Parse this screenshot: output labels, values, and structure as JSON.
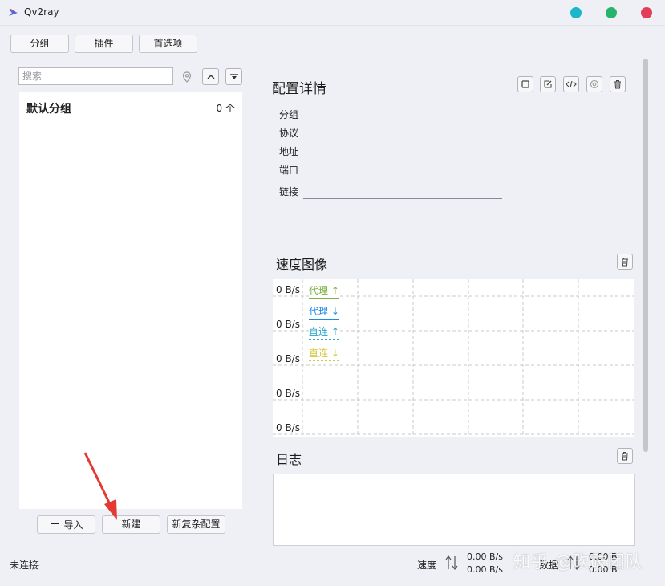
{
  "window": {
    "title": "Qv2ray"
  },
  "toolbar": {
    "groups_label": "分组",
    "plugins_label": "插件",
    "preferences_label": "首选项"
  },
  "search": {
    "placeholder": "搜索"
  },
  "group_list": {
    "items": [
      {
        "name": "默认分组",
        "count": "0 个"
      }
    ]
  },
  "bottom_buttons": {
    "import_label": "导入",
    "new_label": "新建",
    "new_complex_label": "新复杂配置"
  },
  "config_details": {
    "title": "配置详情",
    "fields": {
      "group": "分组",
      "protocol": "协议",
      "address": "地址",
      "port": "端口",
      "link": "链接"
    }
  },
  "speed_chart": {
    "title": "速度图像",
    "y_labels": [
      "0 B/s",
      "0 B/s",
      "0 B/s",
      "0 B/s",
      "0 B/s"
    ],
    "legend": [
      {
        "label": "代理 ↑",
        "color": "#7cb342"
      },
      {
        "label": "代理 ↓",
        "color": "#1e88e5"
      },
      {
        "label": "直连 ↑",
        "color": "#26a6c8"
      },
      {
        "label": "直连 ↓",
        "color": "#d4c83a"
      }
    ]
  },
  "log": {
    "title": "日志"
  },
  "status": {
    "connection": "未连接",
    "speed_label": "速度",
    "speed_up": "0.00 B/s",
    "speed_down": "0.00 B/s",
    "data_label": "数据",
    "data_up": "0.00 B",
    "data_down": "0.00 B"
  },
  "watermark": "知乎 @砍破团队"
}
